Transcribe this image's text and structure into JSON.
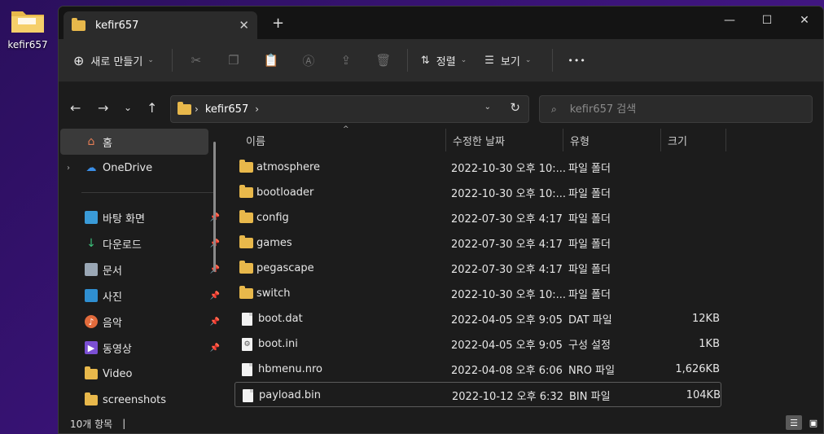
{
  "desktop": {
    "icon_label": "kefir657"
  },
  "tab": {
    "title": "kefir657",
    "close": "✕",
    "new": "+"
  },
  "window_controls": {
    "minimize": "—",
    "maximize": "☐",
    "close": "✕"
  },
  "toolbar": {
    "new_label": "새로 만들기",
    "sort_label": "정렬",
    "view_label": "보기",
    "more": "•••",
    "disabled_icons": [
      "cut-icon",
      "copy-icon",
      "paste-icon",
      "rename-icon",
      "share-icon",
      "delete-icon"
    ]
  },
  "address": {
    "crumb": "kefir657"
  },
  "search": {
    "placeholder": "kefir657 검색"
  },
  "sidebar": {
    "items": [
      {
        "label": "홈",
        "icon": "home-icon",
        "pinned": false
      },
      {
        "label": "OneDrive",
        "icon": "cloud-icon",
        "pinned": false
      },
      {
        "label": "바탕 화면",
        "icon": "desktop-icon",
        "pinned": true
      },
      {
        "label": "다운로드",
        "icon": "download-icon",
        "pinned": true
      },
      {
        "label": "문서",
        "icon": "document-icon",
        "pinned": true
      },
      {
        "label": "사진",
        "icon": "picture-icon",
        "pinned": true
      },
      {
        "label": "음악",
        "icon": "music-icon",
        "pinned": true
      },
      {
        "label": "동영상",
        "icon": "video-icon",
        "pinned": true
      },
      {
        "label": "Video",
        "icon": "folder-icon",
        "pinned": false
      },
      {
        "label": "screenshots",
        "icon": "folder-icon",
        "pinned": false
      }
    ]
  },
  "columns": {
    "name": "이름",
    "modified": "수정한 날짜",
    "type": "유형",
    "size": "크기"
  },
  "files": [
    {
      "name": "atmosphere",
      "modified": "2022-10-30 오후 10:...",
      "type": "파일 폴더",
      "size": "",
      "kind": "folder"
    },
    {
      "name": "bootloader",
      "modified": "2022-10-30 오후 10:...",
      "type": "파일 폴더",
      "size": "",
      "kind": "folder"
    },
    {
      "name": "config",
      "modified": "2022-07-30 오후 4:17",
      "type": "파일 폴더",
      "size": "",
      "kind": "folder"
    },
    {
      "name": "games",
      "modified": "2022-07-30 오후 4:17",
      "type": "파일 폴더",
      "size": "",
      "kind": "folder"
    },
    {
      "name": "pegascape",
      "modified": "2022-07-30 오후 4:17",
      "type": "파일 폴더",
      "size": "",
      "kind": "folder"
    },
    {
      "name": "switch",
      "modified": "2022-10-30 오후 10:...",
      "type": "파일 폴더",
      "size": "",
      "kind": "folder"
    },
    {
      "name": "boot.dat",
      "modified": "2022-04-05 오후 9:05",
      "type": "DAT 파일",
      "size": "12KB",
      "kind": "file"
    },
    {
      "name": "boot.ini",
      "modified": "2022-04-05 오후 9:05",
      "type": "구성 설정",
      "size": "1KB",
      "kind": "ini"
    },
    {
      "name": "hbmenu.nro",
      "modified": "2022-04-08 오후 6:06",
      "type": "NRO 파일",
      "size": "1,626KB",
      "kind": "file"
    },
    {
      "name": "payload.bin",
      "modified": "2022-10-12 오후 6:32",
      "type": "BIN 파일",
      "size": "104KB",
      "kind": "file",
      "selected": true
    }
  ],
  "status": {
    "count": "10개 항목",
    "cursor": "|"
  },
  "colors": {
    "folder": "#e8b84b",
    "background": "#1c1c1c",
    "accent": "#3a3a3a"
  }
}
